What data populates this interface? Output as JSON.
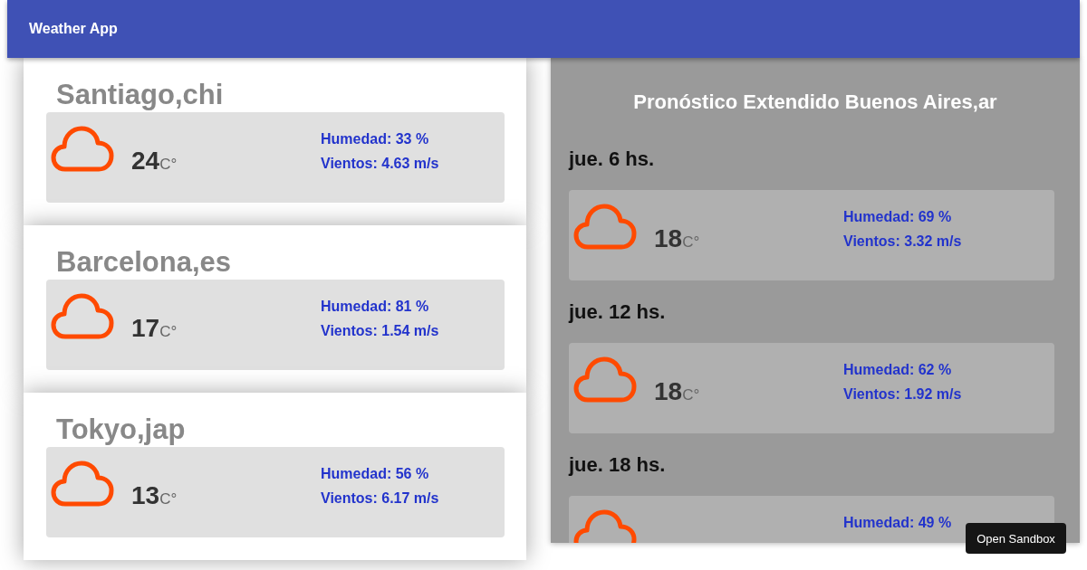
{
  "app_bar": {
    "title": "Weather App"
  },
  "cities": [
    {
      "name": "Santiago,chi",
      "temperature": "24",
      "unit": "C°",
      "humidity": "Humedad: 33 %",
      "wind": "Vientos: 4.63 m/s"
    },
    {
      "name": "Barcelona,es",
      "temperature": "17",
      "unit": "C°",
      "humidity": "Humedad: 81 %",
      "wind": "Vientos: 1.54 m/s"
    },
    {
      "name": "Tokyo,jap",
      "temperature": "13",
      "unit": "C°",
      "humidity": "Humedad: 56 %",
      "wind": "Vientos: 6.17 m/s"
    }
  ],
  "forecast": {
    "title": "Pronóstico Extendido Buenos Aires,ar",
    "items": [
      {
        "day": "jue. 6 hs.",
        "temperature": "18",
        "unit": "C°",
        "humidity": "Humedad: 69 %",
        "wind": "Vientos: 3.32 m/s"
      },
      {
        "day": "jue. 12 hs.",
        "temperature": "18",
        "unit": "C°",
        "humidity": "Humedad: 62 %",
        "wind": "Vientos: 1.92 m/s"
      },
      {
        "day": "jue. 18 hs.",
        "humidity": "Humedad: 49 %"
      }
    ]
  },
  "sandbox_button": {
    "label": "Open Sandbox"
  }
}
